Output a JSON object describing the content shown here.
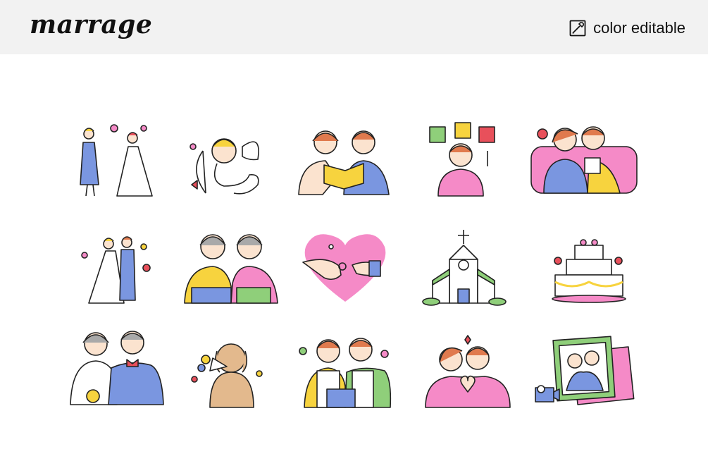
{
  "header": {
    "title": "marrage",
    "editable_label": "color editable",
    "editable_icon": "color-picker-icon"
  },
  "colors": {
    "header_bg": "#f2f2f2",
    "outline": "#222222",
    "blue": "#7a96e0",
    "pink": "#f58ac7",
    "yellow": "#f7d33e",
    "green": "#8fcf7a",
    "red": "#e8505b",
    "skin": "#fbe3cf",
    "hair_brown": "#e07a4e"
  },
  "illustrations": [
    {
      "icon": "bridesmaid-and-bride-icon"
    },
    {
      "icon": "cupid-icon"
    },
    {
      "icon": "couple-reading-book-icon"
    },
    {
      "icon": "woman-choosing-dress-icon"
    },
    {
      "icon": "couple-on-sofa-icon"
    },
    {
      "icon": "bride-and-groom-icon"
    },
    {
      "icon": "grandmothers-hanbok-icon"
    },
    {
      "icon": "ring-heart-icon"
    },
    {
      "icon": "wedding-chapel-icon"
    },
    {
      "icon": "wedding-cake-icon"
    },
    {
      "icon": "senior-couple-icon"
    },
    {
      "icon": "dog-with-bouquet-icon"
    },
    {
      "icon": "couple-cooking-icon"
    },
    {
      "icon": "couple-heart-hands-icon"
    },
    {
      "icon": "photo-frame-camera-icon"
    }
  ]
}
